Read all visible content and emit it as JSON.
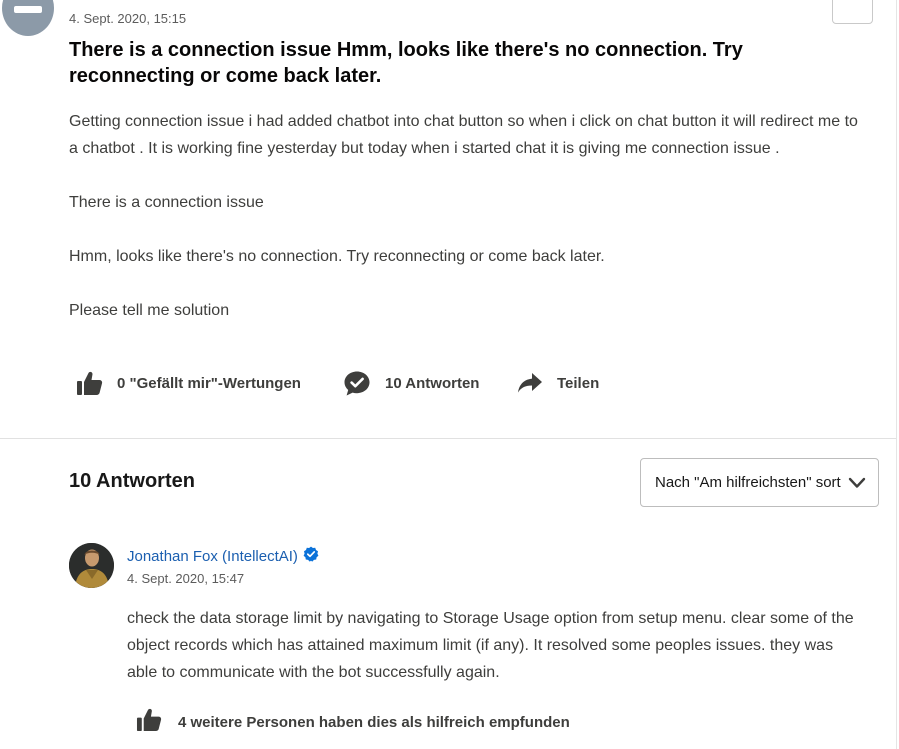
{
  "question": {
    "date": "4. Sept. 2020, 15:15",
    "title": "There is a connection issue Hmm, looks like there's no connection. Try reconnecting or come back later.",
    "body": [
      "Getting connection issue i had added chatbot into chat button so when i click on chat button it will redirect me to a chatbot . It is working fine yesterday but today when i started chat it is giving me connection issue .",
      "There is a connection issue",
      "Hmm, looks like there's no connection. Try reconnecting or come back later.",
      "Please tell me solution"
    ],
    "actions": {
      "like_label": "0 \"Gefällt mir\"-Wertungen",
      "answers_label": "10 Antworten",
      "share_label": "Teilen"
    }
  },
  "answers": {
    "heading": "10 Antworten",
    "sort_selected": "Nach \"Am hilfreichsten\" sortieren",
    "items": [
      {
        "author": "Jonathan Fox (IntellectAI)",
        "verified": true,
        "date": "4. Sept. 2020, 15:47",
        "body": "check the data storage limit by navigating to Storage Usage option from setup menu. clear some of the object records which has attained maximum limit (if any). It resolved some peoples issues. they was able to communicate with the bot successfully again.",
        "helpful_label": "4 weitere Personen haben dies als hilfreich empfunden"
      }
    ]
  },
  "icons": {
    "like": "thumbs-up-icon",
    "answers": "chat-check-icon",
    "share": "share-arrow-icon",
    "sort": "chevron-down-icon",
    "verified": "verified-badge-icon"
  },
  "colors": {
    "link": "#1b5fb0",
    "text": "#3e3e3c",
    "verified_badge": "#0b72d9",
    "avatar_placeholder": "#8c9aa8"
  }
}
